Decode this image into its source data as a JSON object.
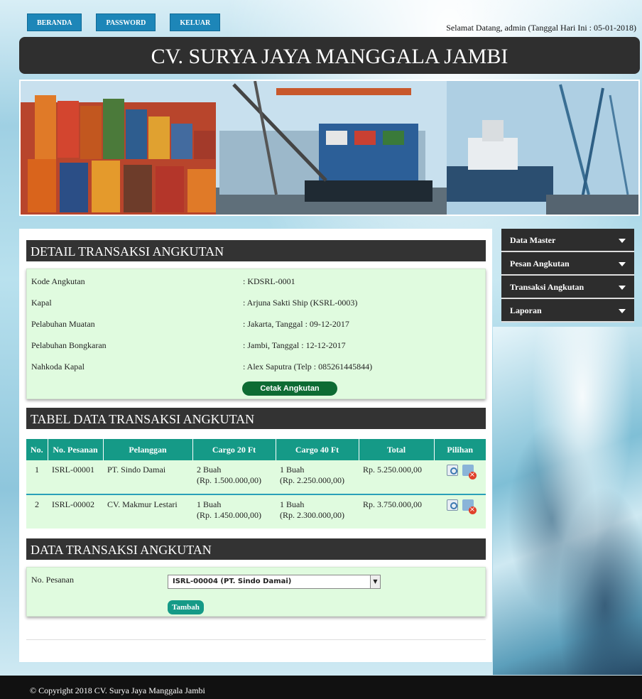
{
  "nav": {
    "items": [
      "BERANDA",
      "PASSWORD",
      "KELUAR"
    ]
  },
  "welcome": "Selamat Datang, admin (Tanggal Hari Ini : 05-01-2018)",
  "site_title": "CV. SURYA JAYA MANGGALA JAMBI",
  "detail": {
    "heading": "DETAIL TRANSAKSI ANGKUTAN",
    "rows": [
      {
        "label": "Kode Angkutan",
        "value": ": KDSRL-0001"
      },
      {
        "label": "Kapal",
        "value": ": Arjuna Sakti Ship (KSRL-0003)"
      },
      {
        "label": "Pelabuhan Muatan",
        "value": ": Jakarta, Tanggal : 09-12-2017"
      },
      {
        "label": "Pelabuhan Bongkaran",
        "value": ": Jambi, Tanggal : 12-12-2017"
      },
      {
        "label": "Nahkoda Kapal",
        "value": ": Alex Saputra (Telp : 085261445844)"
      }
    ],
    "print_button": "Cetak Angkutan"
  },
  "table": {
    "heading": "TABEL DATA TRANSAKSI ANGKUTAN",
    "columns": [
      "No.",
      "No. Pesanan",
      "Pelanggan",
      "Cargo 20 Ft",
      "Cargo 40 Ft",
      "Total",
      "Pilihan"
    ],
    "rows": [
      {
        "no": "1",
        "pesanan": "ISRL-00001",
        "pelanggan": "PT. Sindo Damai",
        "c20_qty": "2 Buah",
        "c20_price": "(Rp. 1.500.000,00)",
        "c40_qty": "1 Buah",
        "c40_price": "(Rp. 2.250.000,00)",
        "total": "Rp. 5.250.000,00"
      },
      {
        "no": "2",
        "pesanan": "ISRL-00002",
        "pelanggan": "CV. Makmur Lestari",
        "c20_qty": "1 Buah",
        "c20_price": "(Rp. 1.450.000,00)",
        "c40_qty": "1 Buah",
        "c40_price": "(Rp. 2.300.000,00)",
        "total": "Rp. 3.750.000,00"
      }
    ]
  },
  "form": {
    "heading": "DATA TRANSAKSI ANGKUTAN",
    "label": "No. Pesanan",
    "selected": "ISRL-00004 (PT. Sindo Damai)",
    "add_button": "Tambah"
  },
  "sidebar": {
    "items": [
      "Data Master",
      "Pesan Angkutan",
      "Transaksi Angkutan",
      "Laporan"
    ]
  },
  "footer": "© Copyright 2018 CV. Surya Jaya Manggala Jambi"
}
